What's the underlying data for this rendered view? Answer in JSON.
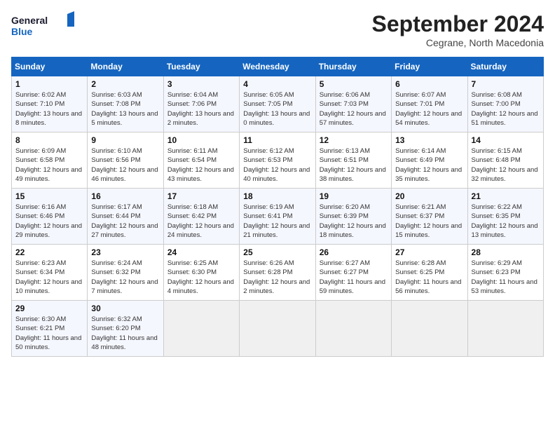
{
  "header": {
    "logo_line1": "General",
    "logo_line2": "Blue",
    "month_title": "September 2024",
    "subtitle": "Cegrane, North Macedonia"
  },
  "days_of_week": [
    "Sunday",
    "Monday",
    "Tuesday",
    "Wednesday",
    "Thursday",
    "Friday",
    "Saturday"
  ],
  "weeks": [
    [
      {
        "day": "1",
        "sunrise": "6:02 AM",
        "sunset": "7:10 PM",
        "daylight": "13 hours and 8 minutes."
      },
      {
        "day": "2",
        "sunrise": "6:03 AM",
        "sunset": "7:08 PM",
        "daylight": "13 hours and 5 minutes."
      },
      {
        "day": "3",
        "sunrise": "6:04 AM",
        "sunset": "7:06 PM",
        "daylight": "13 hours and 2 minutes."
      },
      {
        "day": "4",
        "sunrise": "6:05 AM",
        "sunset": "7:05 PM",
        "daylight": "13 hours and 0 minutes."
      },
      {
        "day": "5",
        "sunrise": "6:06 AM",
        "sunset": "7:03 PM",
        "daylight": "12 hours and 57 minutes."
      },
      {
        "day": "6",
        "sunrise": "6:07 AM",
        "sunset": "7:01 PM",
        "daylight": "12 hours and 54 minutes."
      },
      {
        "day": "7",
        "sunrise": "6:08 AM",
        "sunset": "7:00 PM",
        "daylight": "12 hours and 51 minutes."
      }
    ],
    [
      {
        "day": "8",
        "sunrise": "6:09 AM",
        "sunset": "6:58 PM",
        "daylight": "12 hours and 49 minutes."
      },
      {
        "day": "9",
        "sunrise": "6:10 AM",
        "sunset": "6:56 PM",
        "daylight": "12 hours and 46 minutes."
      },
      {
        "day": "10",
        "sunrise": "6:11 AM",
        "sunset": "6:54 PM",
        "daylight": "12 hours and 43 minutes."
      },
      {
        "day": "11",
        "sunrise": "6:12 AM",
        "sunset": "6:53 PM",
        "daylight": "12 hours and 40 minutes."
      },
      {
        "day": "12",
        "sunrise": "6:13 AM",
        "sunset": "6:51 PM",
        "daylight": "12 hours and 38 minutes."
      },
      {
        "day": "13",
        "sunrise": "6:14 AM",
        "sunset": "6:49 PM",
        "daylight": "12 hours and 35 minutes."
      },
      {
        "day": "14",
        "sunrise": "6:15 AM",
        "sunset": "6:48 PM",
        "daylight": "12 hours and 32 minutes."
      }
    ],
    [
      {
        "day": "15",
        "sunrise": "6:16 AM",
        "sunset": "6:46 PM",
        "daylight": "12 hours and 29 minutes."
      },
      {
        "day": "16",
        "sunrise": "6:17 AM",
        "sunset": "6:44 PM",
        "daylight": "12 hours and 27 minutes."
      },
      {
        "day": "17",
        "sunrise": "6:18 AM",
        "sunset": "6:42 PM",
        "daylight": "12 hours and 24 minutes."
      },
      {
        "day": "18",
        "sunrise": "6:19 AM",
        "sunset": "6:41 PM",
        "daylight": "12 hours and 21 minutes."
      },
      {
        "day": "19",
        "sunrise": "6:20 AM",
        "sunset": "6:39 PM",
        "daylight": "12 hours and 18 minutes."
      },
      {
        "day": "20",
        "sunrise": "6:21 AM",
        "sunset": "6:37 PM",
        "daylight": "12 hours and 15 minutes."
      },
      {
        "day": "21",
        "sunrise": "6:22 AM",
        "sunset": "6:35 PM",
        "daylight": "12 hours and 13 minutes."
      }
    ],
    [
      {
        "day": "22",
        "sunrise": "6:23 AM",
        "sunset": "6:34 PM",
        "daylight": "12 hours and 10 minutes."
      },
      {
        "day": "23",
        "sunrise": "6:24 AM",
        "sunset": "6:32 PM",
        "daylight": "12 hours and 7 minutes."
      },
      {
        "day": "24",
        "sunrise": "6:25 AM",
        "sunset": "6:30 PM",
        "daylight": "12 hours and 4 minutes."
      },
      {
        "day": "25",
        "sunrise": "6:26 AM",
        "sunset": "6:28 PM",
        "daylight": "12 hours and 2 minutes."
      },
      {
        "day": "26",
        "sunrise": "6:27 AM",
        "sunset": "6:27 PM",
        "daylight": "11 hours and 59 minutes."
      },
      {
        "day": "27",
        "sunrise": "6:28 AM",
        "sunset": "6:25 PM",
        "daylight": "11 hours and 56 minutes."
      },
      {
        "day": "28",
        "sunrise": "6:29 AM",
        "sunset": "6:23 PM",
        "daylight": "11 hours and 53 minutes."
      }
    ],
    [
      {
        "day": "29",
        "sunrise": "6:30 AM",
        "sunset": "6:21 PM",
        "daylight": "11 hours and 50 minutes."
      },
      {
        "day": "30",
        "sunrise": "6:32 AM",
        "sunset": "6:20 PM",
        "daylight": "11 hours and 48 minutes."
      },
      null,
      null,
      null,
      null,
      null
    ]
  ],
  "labels": {
    "sunrise": "Sunrise:",
    "sunset": "Sunset:",
    "daylight": "Daylight:"
  }
}
